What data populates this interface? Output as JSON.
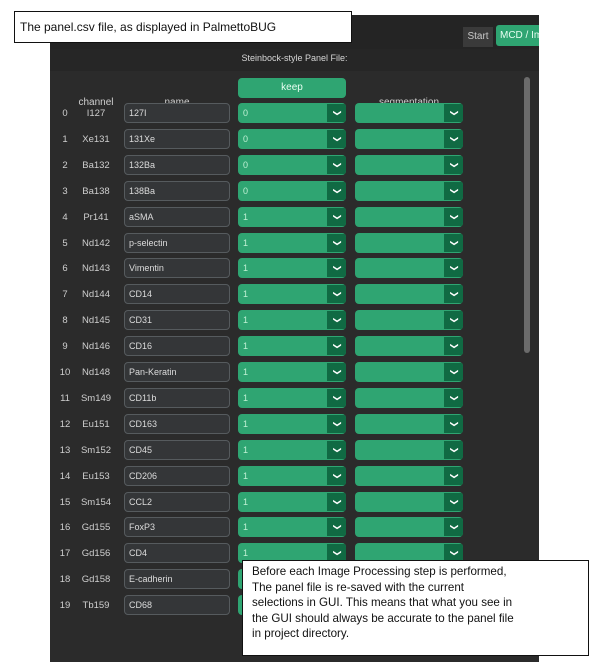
{
  "callouts": {
    "top": "The panel.csv file, as displayed in PalmettoBUG",
    "bottom_lines": [
      "Before each Image Processing step is performed,",
      "The panel file is re-saved with the current",
      "selections in GUI. This means that what you see in",
      "the GUI should always be accurate to the panel file",
      "in project directory."
    ]
  },
  "app": {
    "start_label": "Start",
    "mcd_tab_label": "MCD / Im",
    "panel_title": "Steinbock-style Panel File:",
    "columns": {
      "channel": "channel",
      "name": "name",
      "keep": "keep",
      "segmentation": "segmentation"
    }
  },
  "panel_rows": [
    {
      "idx": "0",
      "channel": "I127",
      "name": "127I",
      "keep": "0",
      "segmentation": ""
    },
    {
      "idx": "1",
      "channel": "Xe131",
      "name": "131Xe",
      "keep": "0",
      "segmentation": ""
    },
    {
      "idx": "2",
      "channel": "Ba132",
      "name": "132Ba",
      "keep": "0",
      "segmentation": ""
    },
    {
      "idx": "3",
      "channel": "Ba138",
      "name": "138Ba",
      "keep": "0",
      "segmentation": ""
    },
    {
      "idx": "4",
      "channel": "Pr141",
      "name": "aSMA",
      "keep": "1",
      "segmentation": ""
    },
    {
      "idx": "5",
      "channel": "Nd142",
      "name": "p-selectin",
      "keep": "1",
      "segmentation": ""
    },
    {
      "idx": "6",
      "channel": "Nd143",
      "name": "Vimentin",
      "keep": "1",
      "segmentation": ""
    },
    {
      "idx": "7",
      "channel": "Nd144",
      "name": "CD14",
      "keep": "1",
      "segmentation": ""
    },
    {
      "idx": "8",
      "channel": "Nd145",
      "name": "CD31",
      "keep": "1",
      "segmentation": ""
    },
    {
      "idx": "9",
      "channel": "Nd146",
      "name": "CD16",
      "keep": "1",
      "segmentation": ""
    },
    {
      "idx": "10",
      "channel": "Nd148",
      "name": "Pan-Keratin",
      "keep": "1",
      "segmentation": ""
    },
    {
      "idx": "11",
      "channel": "Sm149",
      "name": "CD11b",
      "keep": "1",
      "segmentation": ""
    },
    {
      "idx": "12",
      "channel": "Eu151",
      "name": "CD163",
      "keep": "1",
      "segmentation": ""
    },
    {
      "idx": "13",
      "channel": "Sm152",
      "name": "CD45",
      "keep": "1",
      "segmentation": ""
    },
    {
      "idx": "14",
      "channel": "Eu153",
      "name": "CD206",
      "keep": "1",
      "segmentation": ""
    },
    {
      "idx": "15",
      "channel": "Sm154",
      "name": "CCL2",
      "keep": "1",
      "segmentation": ""
    },
    {
      "idx": "16",
      "channel": "Gd155",
      "name": "FoxP3",
      "keep": "1",
      "segmentation": ""
    },
    {
      "idx": "17",
      "channel": "Gd156",
      "name": "CD4",
      "keep": "1",
      "segmentation": ""
    },
    {
      "idx": "18",
      "channel": "Gd158",
      "name": "E-cadherin",
      "keep": "1",
      "segmentation": ""
    },
    {
      "idx": "19",
      "channel": "Tb159",
      "name": "CD68",
      "keep": "1",
      "segmentation": ""
    }
  ],
  "icons": {
    "dropdown": "chevron-down-icon"
  },
  "colors": {
    "accent_green": "#2fa572",
    "dropdown_arrow_bg": "#106a43",
    "app_background": "#2b2b2b"
  }
}
